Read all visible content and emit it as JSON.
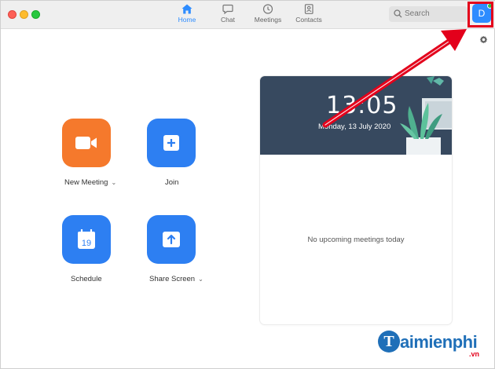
{
  "window": {
    "tabs": [
      {
        "label": "Home",
        "icon": "home-icon",
        "active": true
      },
      {
        "label": "Chat",
        "icon": "chat-icon",
        "active": false
      },
      {
        "label": "Meetings",
        "icon": "clock-icon",
        "active": false
      },
      {
        "label": "Contacts",
        "icon": "contacts-icon",
        "active": false
      }
    ],
    "search": {
      "placeholder": "Search"
    },
    "avatar": {
      "initial": "D",
      "status_color": "#2bc24a"
    }
  },
  "actions": [
    {
      "label": "New Meeting",
      "icon": "video-camera-icon",
      "color": "#f5792c",
      "has_dropdown": true
    },
    {
      "label": "Join",
      "icon": "plus-icon",
      "color": "#2d7ff2",
      "has_dropdown": false
    },
    {
      "label": "Schedule",
      "icon": "calendar-icon",
      "calendar_day": "19",
      "color": "#2d7ff2",
      "has_dropdown": false
    },
    {
      "label": "Share Screen",
      "icon": "share-screen-icon",
      "color": "#2d7ff2",
      "has_dropdown": true
    }
  ],
  "calendar_card": {
    "time": "13:05",
    "date": "Monday, 13 July 2020",
    "empty_message": "No upcoming meetings today"
  },
  "watermark": {
    "logo_letter": "T",
    "brand": "aimienphi",
    "tld": ".vn"
  },
  "colors": {
    "accent": "#2d8cff",
    "highlight": "#e3001b"
  }
}
